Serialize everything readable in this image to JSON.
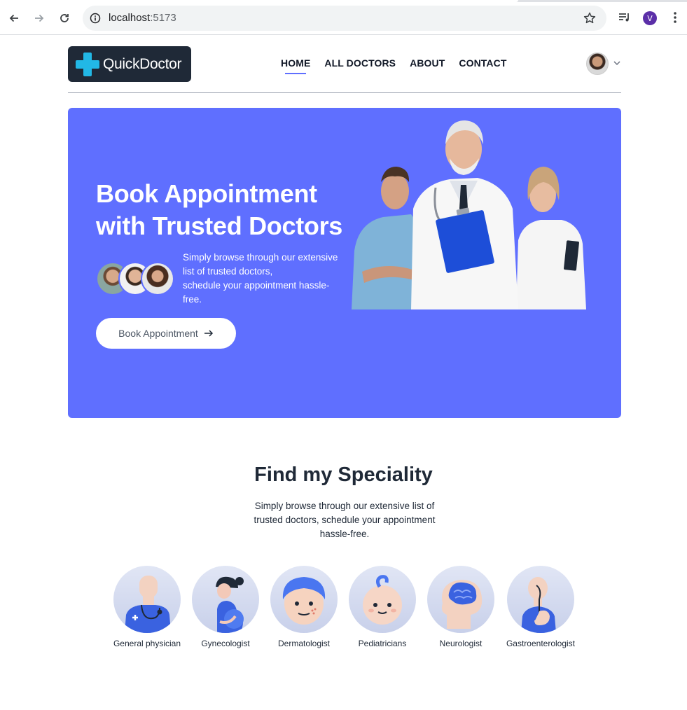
{
  "browser": {
    "url_host": "localhost",
    "url_port": ":5173",
    "profile_initial": "V"
  },
  "header": {
    "logo_text": "QuickDoctor",
    "nav": [
      {
        "label": "HOME",
        "active": true
      },
      {
        "label": "ALL DOCTORS",
        "active": false
      },
      {
        "label": "ABOUT",
        "active": false
      },
      {
        "label": "CONTACT",
        "active": false
      }
    ]
  },
  "hero": {
    "title_line1": "Book Appointment",
    "title_line2": "with Trusted Doctors",
    "description_line1": "Simply browse through our extensive list of trusted doctors,",
    "description_line2": "schedule your appointment hassle-free.",
    "cta_label": "Book Appointment",
    "cta_icon": "arrow-right-icon"
  },
  "speciality": {
    "title": "Find my Speciality",
    "description": "Simply browse through our extensive list of trusted doctors, schedule your appointment hassle-free.",
    "items": [
      {
        "label": "General physician",
        "icon": "general-physician-icon"
      },
      {
        "label": "Gynecologist",
        "icon": "gynecologist-icon"
      },
      {
        "label": "Dermatologist",
        "icon": "dermatologist-icon"
      },
      {
        "label": "Pediatricians",
        "icon": "pediatrician-icon"
      },
      {
        "label": "Neurologist",
        "icon": "neurologist-icon"
      },
      {
        "label": "Gastroenterologist",
        "icon": "gastroenterologist-icon"
      }
    ]
  },
  "colors": {
    "primary": "#5f6fff",
    "logo_bg": "#1f2937",
    "logo_accent": "#22b8e6",
    "text_dark": "#1f2937"
  }
}
